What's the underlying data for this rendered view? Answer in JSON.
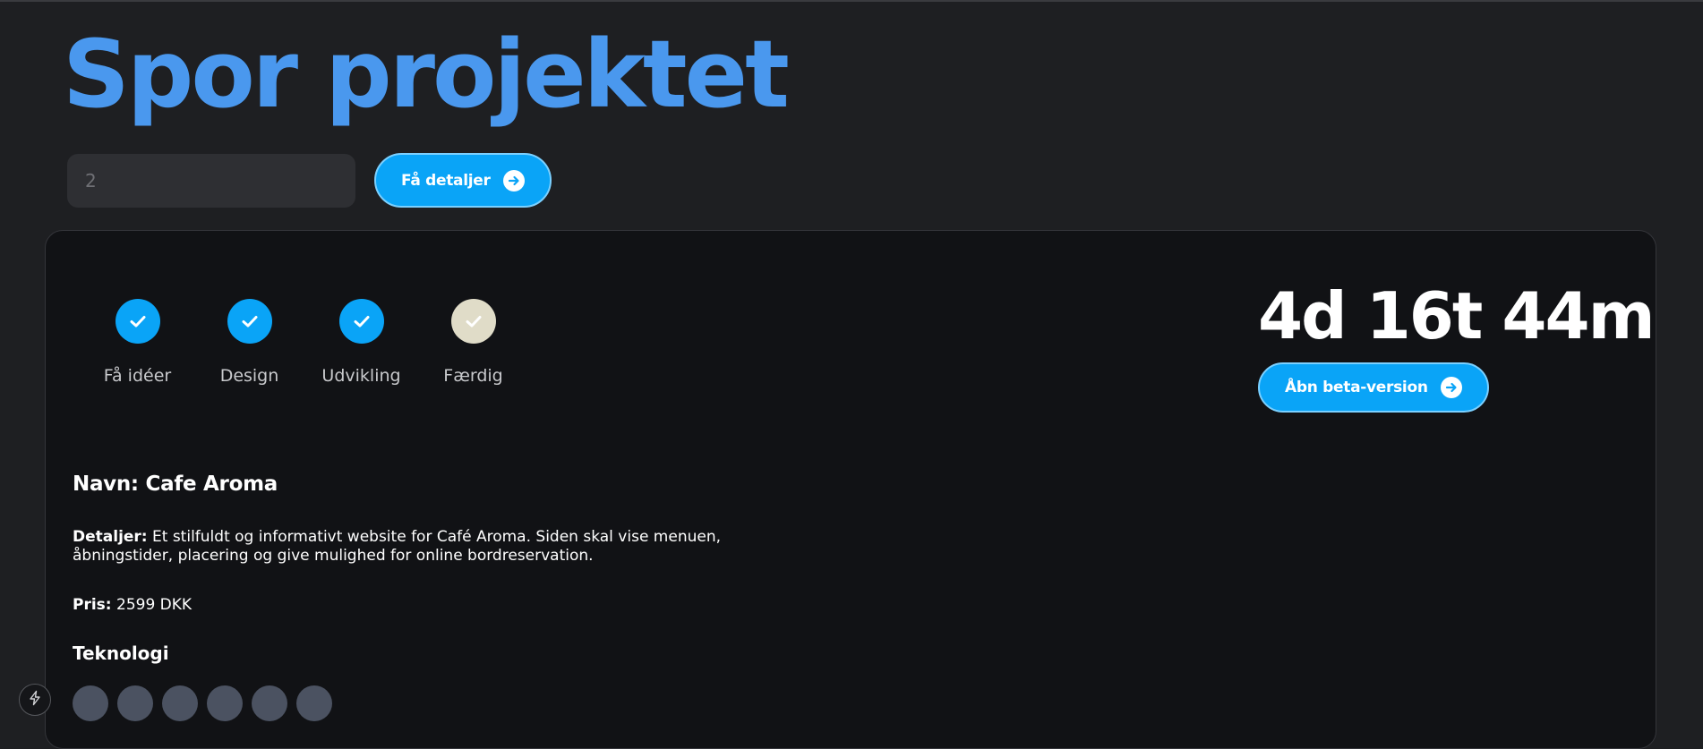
{
  "page": {
    "title": "Spor projektet"
  },
  "search": {
    "value": "2",
    "button_label": "Få detaljer",
    "button_icon": "arrow-right-circle-icon"
  },
  "progress": {
    "steps": [
      {
        "label": "Få idéer",
        "done": true,
        "icon": "check-icon"
      },
      {
        "label": "Design",
        "done": true,
        "icon": "check-icon"
      },
      {
        "label": "Udvikling",
        "done": true,
        "icon": "check-icon"
      },
      {
        "label": "Færdig",
        "done": false,
        "icon": "check-icon"
      }
    ],
    "colors": {
      "done": "#0aa4f7",
      "pending": "#e0dcc8"
    }
  },
  "countdown": {
    "value": "4d 16t 44m"
  },
  "beta": {
    "button_label": "Åbn beta-version",
    "button_icon": "arrow-right-circle-icon"
  },
  "project": {
    "name": "Navn: Cafe Aroma",
    "details_label": "Detaljer:",
    "details_text": " Et stilfuldt og informativt website for Café Aroma. Siden skal vise menuen, åbningstider, placering og give mulighed for online bordreservation.",
    "price_label": "Pris:",
    "price_value": " 2599 DKK",
    "tech_title": "Teknologi",
    "tech_icons": [
      "tech-icon",
      "tech-icon",
      "tech-icon",
      "tech-icon",
      "tech-icon",
      "tech-icon"
    ]
  },
  "colors": {
    "background": "#1e1f22",
    "card": "#111215",
    "title": "#4a98ee",
    "accent": "#0aa4f7"
  },
  "floating": {
    "icon": "lightning-bolt-icon"
  }
}
